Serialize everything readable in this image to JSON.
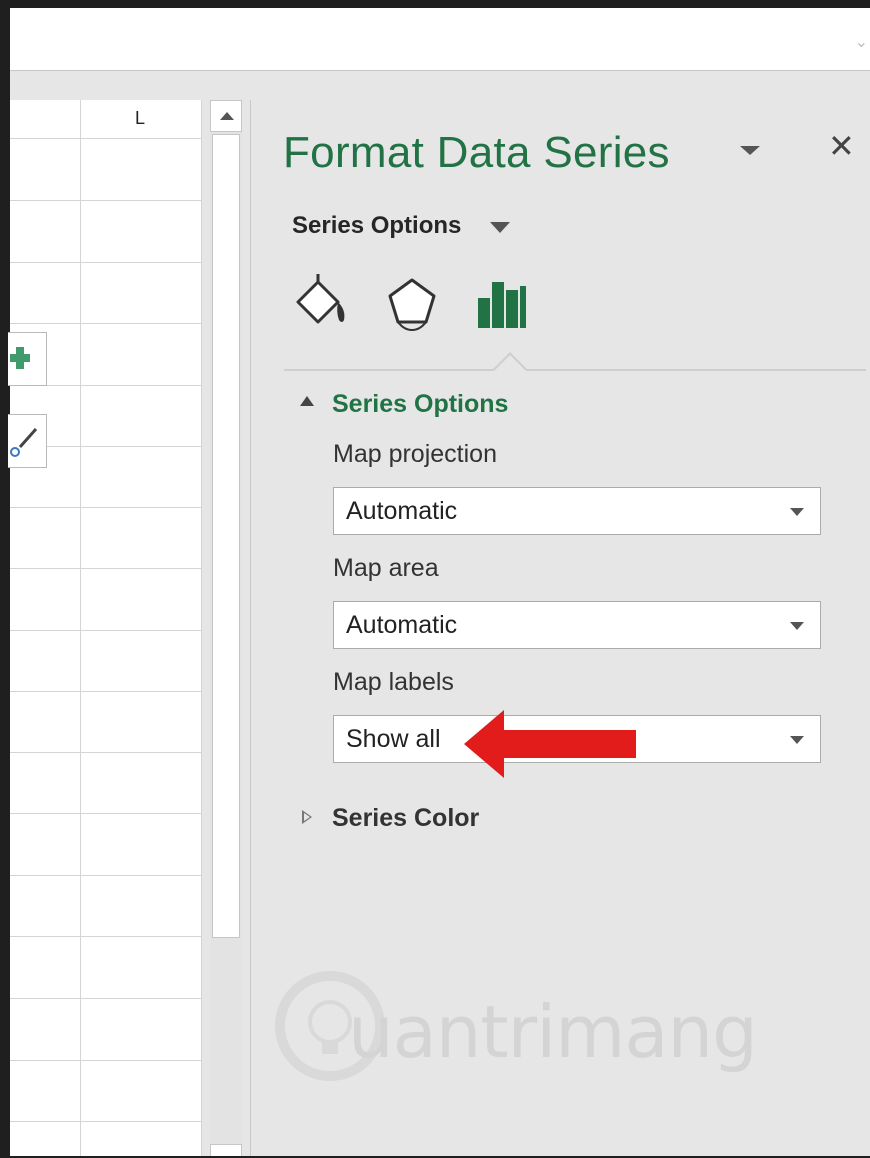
{
  "spreadsheet": {
    "column_header": "L"
  },
  "task_pane": {
    "title": "Format Data Series",
    "options_dropdown_label": "Series Options",
    "tabs": [
      {
        "icon": "fill-bucket-icon"
      },
      {
        "icon": "pentagon-effects-icon"
      },
      {
        "icon": "bar-chart-icon",
        "active": true
      }
    ],
    "section": {
      "title": "Series Options",
      "expanded": true,
      "fields": [
        {
          "label": "Map projection",
          "value": "Automatic"
        },
        {
          "label": "Map area",
          "value": "Automatic"
        },
        {
          "label": "Map labels",
          "value": "Show all"
        }
      ]
    },
    "section2": {
      "title": "Series Color",
      "expanded": false
    }
  },
  "annotation": {
    "arrow_color": "#e21b1b"
  },
  "watermark": {
    "text": "uantrimang",
    "full_name": "Quantrimang"
  },
  "colors": {
    "accent": "#217346",
    "pane_bg": "#e6e6e6"
  }
}
